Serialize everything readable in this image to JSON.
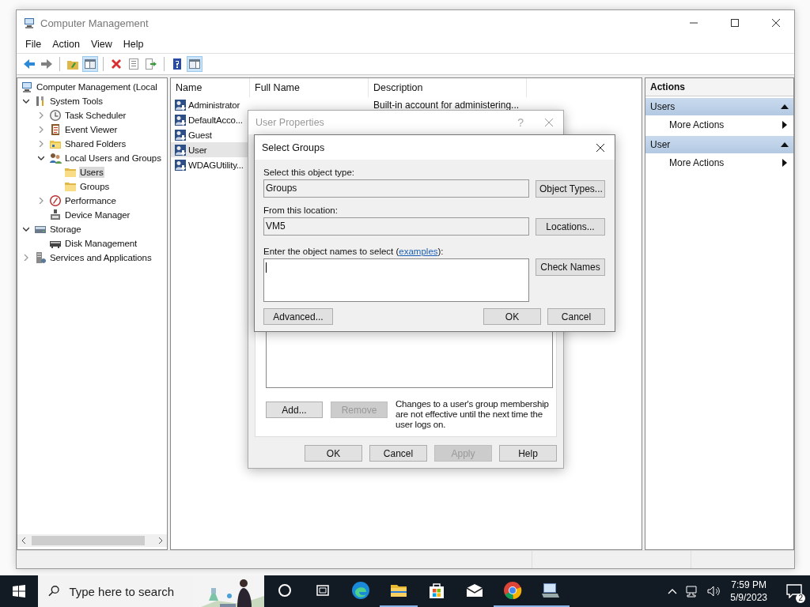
{
  "window": {
    "title": "Computer Management"
  },
  "menu": [
    "File",
    "Action",
    "View",
    "Help"
  ],
  "toolbar": [
    {
      "kind": "back",
      "pressed": false
    },
    {
      "kind": "forward",
      "pressed": false
    },
    {
      "kind": "separator"
    },
    {
      "kind": "up",
      "pressed": false
    },
    {
      "kind": "tree",
      "pressed": true
    },
    {
      "kind": "separator"
    },
    {
      "kind": "delete",
      "pressed": false
    },
    {
      "kind": "properties",
      "pressed": false
    },
    {
      "kind": "export",
      "pressed": false
    },
    {
      "kind": "separator"
    },
    {
      "kind": "help",
      "pressed": false
    },
    {
      "kind": "actionpane",
      "pressed": true
    }
  ],
  "tree": [
    {
      "label": "Computer Management (Local",
      "kind": "computer",
      "selected": false,
      "children": [
        {
          "label": "System Tools",
          "kind": "tools",
          "expanded": true,
          "selected": false,
          "children": [
            {
              "label": "Task Scheduler",
              "kind": "clock",
              "expanded": false,
              "selected": false
            },
            {
              "label": "Event Viewer",
              "kind": "log",
              "expanded": false,
              "selected": false
            },
            {
              "label": "Shared Folders",
              "kind": "share",
              "expanded": false,
              "selected": false
            },
            {
              "label": "Local Users and Groups",
              "kind": "users",
              "expanded": true,
              "selected": false,
              "children": [
                {
                  "label": "Users",
                  "kind": "folder",
                  "selected": true
                },
                {
                  "label": "Groups",
                  "kind": "folder",
                  "selected": false
                }
              ]
            },
            {
              "label": "Performance",
              "kind": "perf",
              "expanded": false,
              "selected": false
            },
            {
              "label": "Device Manager",
              "kind": "device",
              "selected": false
            }
          ]
        },
        {
          "label": "Storage",
          "kind": "storage",
          "expanded": true,
          "selected": false,
          "children": [
            {
              "label": "Disk Management",
              "kind": "disk",
              "selected": false
            }
          ]
        },
        {
          "label": "Services and Applications",
          "kind": "services",
          "expanded": false,
          "selected": false
        }
      ]
    }
  ],
  "list": {
    "columns": [
      "Name",
      "Full Name",
      "Description"
    ],
    "rows": [
      {
        "name": "Administrator",
        "full_name": "",
        "description": "Built-in account for administering...",
        "selected": false
      },
      {
        "name": "DefaultAcco...",
        "selected": false
      },
      {
        "name": "Guest",
        "selected": false
      },
      {
        "name": "User",
        "selected": true
      },
      {
        "name": "WDAGUtility...",
        "selected": false
      }
    ]
  },
  "actions": {
    "title": "Actions",
    "sections": [
      {
        "title": "Users",
        "items": [
          "More Actions"
        ]
      },
      {
        "title": "User",
        "items": [
          "More Actions"
        ]
      }
    ]
  },
  "user_properties": {
    "title": "User Properties",
    "help_glyph": "?",
    "add": "Add...",
    "remove": {
      "label": "Remove",
      "disabled": true
    },
    "note": "Changes to a user's group membership are not effective until the next time the user logs on.",
    "buttons": [
      {
        "label": "OK",
        "disabled": false
      },
      {
        "label": "Cancel",
        "disabled": false
      },
      {
        "label": "Apply",
        "disabled": true
      },
      {
        "label": "Help",
        "disabled": false
      }
    ]
  },
  "select_groups": {
    "title": "Select Groups",
    "type_label": "Select this object type:",
    "type_value": "Groups",
    "type_button": "Object Types...",
    "location_label": "From this location:",
    "location_value": "VM5",
    "location_button": "Locations...",
    "names_label_before": "Enter the object names to select (",
    "names_link": "examples",
    "names_label_after": "):",
    "check_button": "Check Names",
    "advanced": "Advanced...",
    "ok": "OK",
    "cancel": "Cancel"
  },
  "taskbar": {
    "search_placeholder": "Type here to search",
    "apps": [
      {
        "kind": "cortana",
        "running": false
      },
      {
        "kind": "taskview",
        "running": false
      },
      {
        "kind": "edge",
        "running": false
      },
      {
        "kind": "explorer",
        "running": true
      },
      {
        "kind": "store",
        "running": false
      },
      {
        "kind": "mail",
        "running": false
      },
      {
        "kind": "chrome",
        "running": true
      },
      {
        "kind": "compmgmt",
        "running": true
      }
    ],
    "time": "7:59 PM",
    "date": "5/9/2023",
    "notifications": "2"
  }
}
